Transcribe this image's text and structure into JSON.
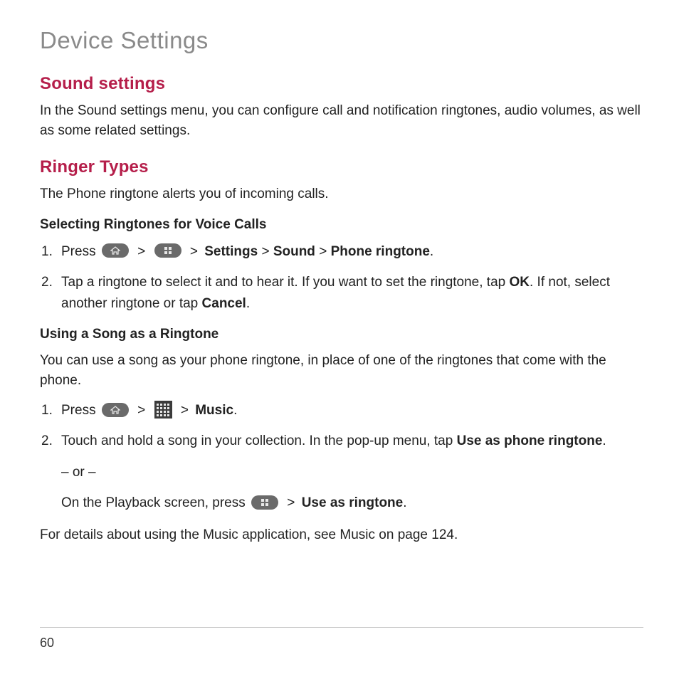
{
  "page": {
    "title": "Device Settings",
    "number": "60"
  },
  "sections": {
    "sound": {
      "heading": "Sound settings",
      "body": "In the Sound settings menu, you can configure call and notification ringtones, audio volumes, as well as some related settings."
    },
    "ringer": {
      "heading": "Ringer Types",
      "body": "The Phone ringtone alerts you of incoming calls.",
      "select_heading": "Selecting Ringtones for Voice Calls",
      "step1_prefix": "Press ",
      "step1_chev": ">",
      "step1_settings": "Settings",
      "step1_sound": "Sound",
      "step1_phone_ringtone": "Phone ringtone",
      "step1_dot": ".",
      "step2_a": "Tap a ringtone to select it and to hear it. If you want to set the ringtone, tap ",
      "step2_ok": "OK",
      "step2_b": ". If not, select another ringtone or tap ",
      "step2_cancel": "Cancel",
      "step2_c": ".",
      "song_heading": "Using a Song as a Ringtone",
      "song_body": "You can use a song as your phone ringtone, in place of one of the ringtones that come with the phone.",
      "song_step1_prefix": " Press ",
      "song_step1_music": "Music",
      "song_step2_a": "Touch and hold a song in your collection. In the pop-up menu, tap ",
      "song_step2_use": "Use as phone ringtone",
      "song_step2_b": ".",
      "or_text": "– or –",
      "playback_a": "On the Playback screen, press ",
      "playback_use": "Use as ringtone",
      "playback_b": ".",
      "footnote": "For details about using the Music application, see Music on page 124."
    }
  }
}
